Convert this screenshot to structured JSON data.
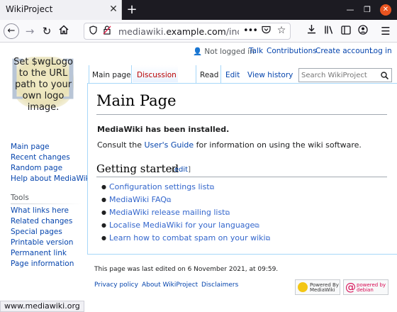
{
  "browser": {
    "tab_title": "WikiProject",
    "tab_close": "✕",
    "new_tab": "+",
    "url_prefix": "mediawiki.",
    "url_domain": "example.com",
    "url_suffix": "/index.p",
    "status_url": "www.mediawiki.org",
    "icons": [
      "back-icon",
      "forward-icon",
      "reload-icon",
      "home-icon",
      "shield-icon",
      "insecure-lock-icon",
      "more-icon",
      "pocket-icon",
      "bookmark-star-icon",
      "download-icon",
      "library-icon",
      "sidebar-icon",
      "account-icon",
      "menu-icon"
    ]
  },
  "logo": {
    "text": "Set $wgLogo to the URL path to your own logo image."
  },
  "personal": {
    "not_logged_in": "Not logged in",
    "talk": "Talk",
    "contributions": "Contributions",
    "create_account": "Create account",
    "log_in": "Log in"
  },
  "tabs": {
    "main_page": "Main page",
    "discussion": "Discussion",
    "read": "Read",
    "edit": "Edit",
    "view_history": "View history"
  },
  "search": {
    "placeholder": "Search WikiProject"
  },
  "sidebar": {
    "navigation": [
      "Main page",
      "Recent changes",
      "Random page",
      "Help about MediaWiki"
    ],
    "tools_heading": "Tools",
    "tools": [
      "What links here",
      "Related changes",
      "Special pages",
      "Printable version",
      "Permanent link",
      "Page information"
    ]
  },
  "content": {
    "title": "Main Page",
    "installed": "MediaWiki has been installed.",
    "consult_before": "Consult the ",
    "consult_link": "User's Guide",
    "consult_after": " for information on using the wiki software.",
    "getting_started": "Getting started",
    "edit_bracket_open": "[",
    "edit_label": "edit",
    "edit_bracket_close": "]",
    "links": [
      "Configuration settings list",
      "MediaWiki FAQ",
      "MediaWiki release mailing list",
      "Localise MediaWiki for your language",
      "Learn how to combat spam on your wiki"
    ]
  },
  "footer": {
    "last_edited": "This page was last edited on 6 November 2021, at 09:59.",
    "privacy": "Privacy policy",
    "about": "About WikiProject",
    "disclaimers": "Disclaimers",
    "powered_mediawiki": "Powered By MediaWiki",
    "powered_debian": "powered by debian"
  },
  "colors": {
    "link": "#0645ad",
    "new_link": "#ba0000",
    "border": "#a7d7f9",
    "close_button": "#e95420"
  }
}
